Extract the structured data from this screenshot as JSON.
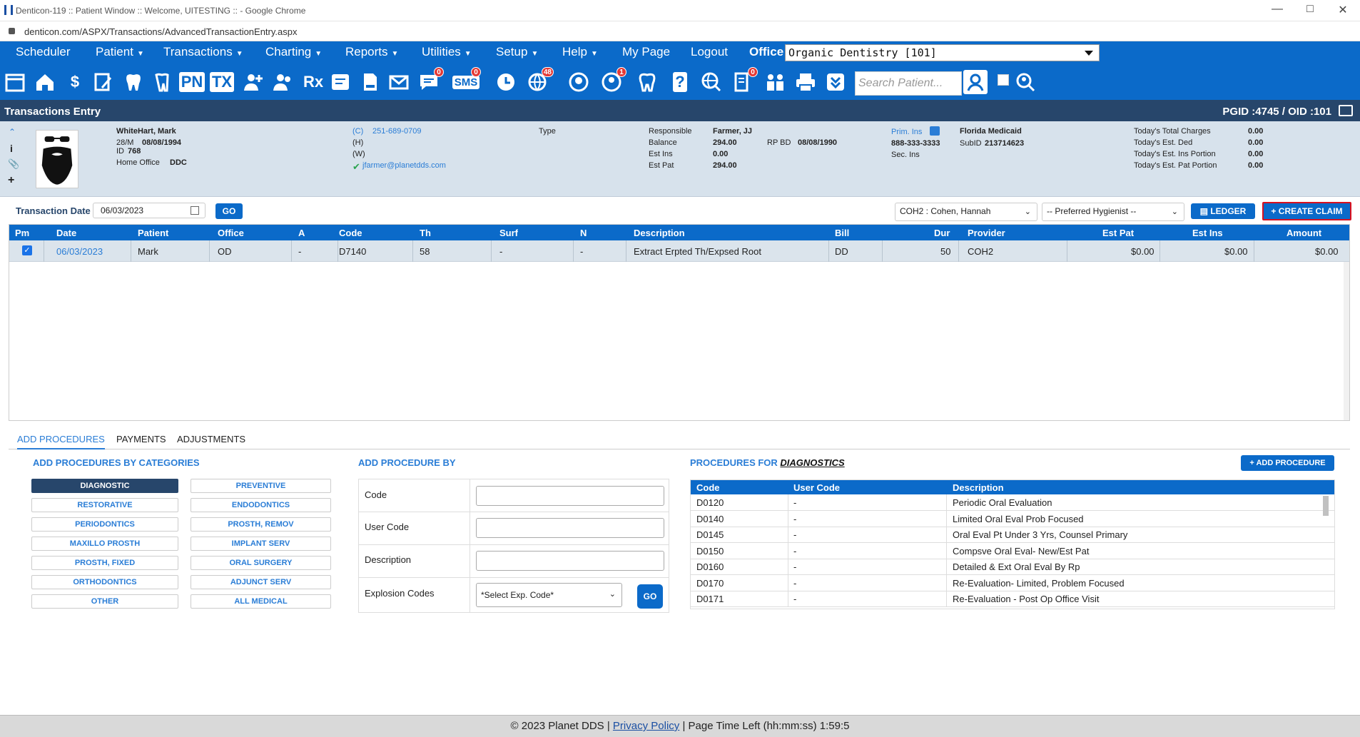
{
  "window": {
    "title": "Denticon-119 :: Patient Window :: Welcome, UITESTING :: - Google Chrome",
    "url": "denticon.com/ASPX/Transactions/AdvancedTransactionEntry.aspx"
  },
  "nav": {
    "items": [
      {
        "label": "Scheduler",
        "caret": false
      },
      {
        "label": "Patient",
        "caret": true
      },
      {
        "label": "Transactions",
        "caret": true
      },
      {
        "label": "Charting",
        "caret": true
      },
      {
        "label": "Reports",
        "caret": true
      },
      {
        "label": "Utilities",
        "caret": true
      },
      {
        "label": "Setup",
        "caret": true
      },
      {
        "label": "Help",
        "caret": true
      },
      {
        "label": "My Page",
        "caret": false
      },
      {
        "label": "Logout",
        "caret": false
      }
    ],
    "office_label": "Office",
    "office_value": "Organic Dentistry [101]"
  },
  "toolbar": {
    "icons": [
      {
        "name": "calendar-icon",
        "glyph": ""
      },
      {
        "name": "home-icon",
        "glyph": ""
      },
      {
        "name": "dollar-icon",
        "glyph": "$"
      },
      {
        "name": "edit-notes-icon",
        "glyph": ""
      },
      {
        "name": "tooth-chart-icon",
        "glyph": ""
      },
      {
        "name": "perio-icon",
        "glyph": ""
      },
      {
        "name": "progress-notes-icon",
        "glyph": "PN"
      },
      {
        "name": "treatment-plan-icon",
        "glyph": "TX"
      },
      {
        "name": "add-patient-icon",
        "glyph": ""
      },
      {
        "name": "add-family-icon",
        "glyph": ""
      },
      {
        "name": "prescription-icon",
        "glyph": "Rx"
      },
      {
        "name": "notes-icon",
        "glyph": ""
      },
      {
        "name": "document-icon",
        "glyph": ""
      },
      {
        "name": "email-icon",
        "glyph": ""
      },
      {
        "name": "messages-icon",
        "glyph": "",
        "badge": "0"
      },
      {
        "name": "sms-icon",
        "glyph": "SMS",
        "badge": "0"
      },
      {
        "name": "clock-icon",
        "glyph": ""
      },
      {
        "name": "online-icon",
        "glyph": "",
        "badge": "48"
      },
      {
        "name": "support-icon",
        "glyph": ""
      },
      {
        "name": "alerts-icon",
        "glyph": "",
        "badge": "1"
      },
      {
        "name": "tooth-icon",
        "glyph": ""
      },
      {
        "name": "help-tooth-icon",
        "glyph": "?"
      },
      {
        "name": "web-search-icon",
        "glyph": ""
      },
      {
        "name": "tasks-icon",
        "glyph": "",
        "badge": "0"
      },
      {
        "name": "family-icon",
        "glyph": ""
      },
      {
        "name": "print-icon",
        "glyph": ""
      },
      {
        "name": "check-download-icon",
        "glyph": ""
      }
    ],
    "search_placeholder": "Search Patient..."
  },
  "header": {
    "title": "Transactions Entry",
    "ids": "PGID :4745  /  OID :101"
  },
  "patient": {
    "name": "WhiteHart, Mark",
    "age_sex": "28/M",
    "dob": "08/08/1994",
    "id_label": "ID",
    "id": "768",
    "home_office_label": "Home Office",
    "home_office": "DDC",
    "phone_c_label": "(C)",
    "phone_c": "251-689-0709",
    "phone_h_label": "(H)",
    "phone_w_label": "(W)",
    "email": "jfarmer@planetdds.com",
    "type_label": "Type",
    "responsible_label": "Responsible",
    "responsible": "Farmer, JJ",
    "balance_label": "Balance",
    "balance": "294.00",
    "rpbd_label": "RP BD",
    "rpbd": "08/08/1990",
    "estins_label": "Est Ins",
    "estins": "0.00",
    "estpat_label": "Est Pat",
    "estpat": "294.00",
    "prim_ins_label": "Prim. Ins",
    "prim_ins": "Florida Medicaid",
    "prim_phone": "888-333-3333",
    "subid_label": "SubID",
    "subid": "213714623",
    "sec_ins_label": "Sec. Ins",
    "today_total_label": "Today's Total Charges",
    "today_total": "0.00",
    "today_ded_label": "Today's Est. Ded",
    "today_ded": "0.00",
    "today_ins_label": "Today's Est. Ins Portion",
    "today_ins": "0.00",
    "today_pat_label": "Today's Est. Pat Portion",
    "today_pat": "0.00"
  },
  "txbar": {
    "date_label": "Transaction Date",
    "date_value": "06/03/2023",
    "go": "GO",
    "provider": "COH2 : Cohen, Hannah",
    "hygienist": "-- Preferred Hygienist --",
    "ledger": "LEDGER",
    "create_claim": "CREATE CLAIM"
  },
  "grid": {
    "columns": [
      "Pm",
      "Date",
      "Patient",
      "Office",
      "A",
      "Code",
      "Th",
      "Surf",
      "N",
      "Description",
      "Bill",
      "Dur",
      "Provider",
      "Est Pat",
      "Est Ins",
      "Amount"
    ],
    "rows": [
      {
        "date": "06/03/2023",
        "patient": "Mark",
        "office": "OD",
        "a": "-",
        "code": "D7140",
        "th": "58",
        "surf": "-",
        "n": "-",
        "description": "Extract Erpted Th/Expsed Root",
        "bill": "DD",
        "dur": "50",
        "provider": "COH2",
        "estpat": "$0.00",
        "estins": "$0.00",
        "amount": "$0.00"
      }
    ]
  },
  "tabs": [
    "ADD PROCEDURES",
    "PAYMENTS",
    "ADJUSTMENTS"
  ],
  "categories": {
    "title": "ADD PROCEDURES BY CATEGORIES",
    "left": [
      "DIAGNOSTIC",
      "RESTORATIVE",
      "PERIODONTICS",
      "MAXILLO PROSTH",
      "PROSTH, FIXED",
      "ORTHODONTICS",
      "OTHER"
    ],
    "right": [
      "PREVENTIVE",
      "ENDODONTICS",
      "PROSTH, REMOV",
      "IMPLANT SERV",
      "ORAL SURGERY",
      "ADJUNCT SERV",
      "ALL MEDICAL"
    ]
  },
  "addby": {
    "title": "ADD PROCEDURE BY",
    "code": "Code",
    "user_code": "User Code",
    "description": "Description",
    "explosion": "Explosion Codes",
    "explosion_value": "*Select Exp. Code*",
    "go": "GO"
  },
  "procedures": {
    "title_prefix": "PROCEDURES FOR",
    "title_cat": "DIAGNOSTICS",
    "add_button": "ADD PROCEDURE",
    "columns": [
      "Code",
      "User Code",
      "Description"
    ],
    "rows": [
      {
        "code": "D0120",
        "user": "-",
        "desc": "Periodic Oral Evaluation"
      },
      {
        "code": "D0140",
        "user": "-",
        "desc": "Limited Oral Eval Prob Focused"
      },
      {
        "code": "D0145",
        "user": "-",
        "desc": "Oral Eval Pt Under 3 Yrs, Counsel Primary"
      },
      {
        "code": "D0150",
        "user": "-",
        "desc": "Compsve Oral Eval- New/Est Pat"
      },
      {
        "code": "D0160",
        "user": "-",
        "desc": "Detailed & Ext Oral Eval By Rp"
      },
      {
        "code": "D0170",
        "user": "-",
        "desc": "Re-Evaluation- Limited, Problem Focused"
      },
      {
        "code": "D0171",
        "user": "-",
        "desc": "Re-Evaluation - Post Op Office Visit"
      }
    ]
  },
  "footer": {
    "copyright": "© 2023 Planet DDS |",
    "privacy": "Privacy Policy",
    "time": "| Page Time Left (hh:mm:ss) 1:59:5"
  }
}
